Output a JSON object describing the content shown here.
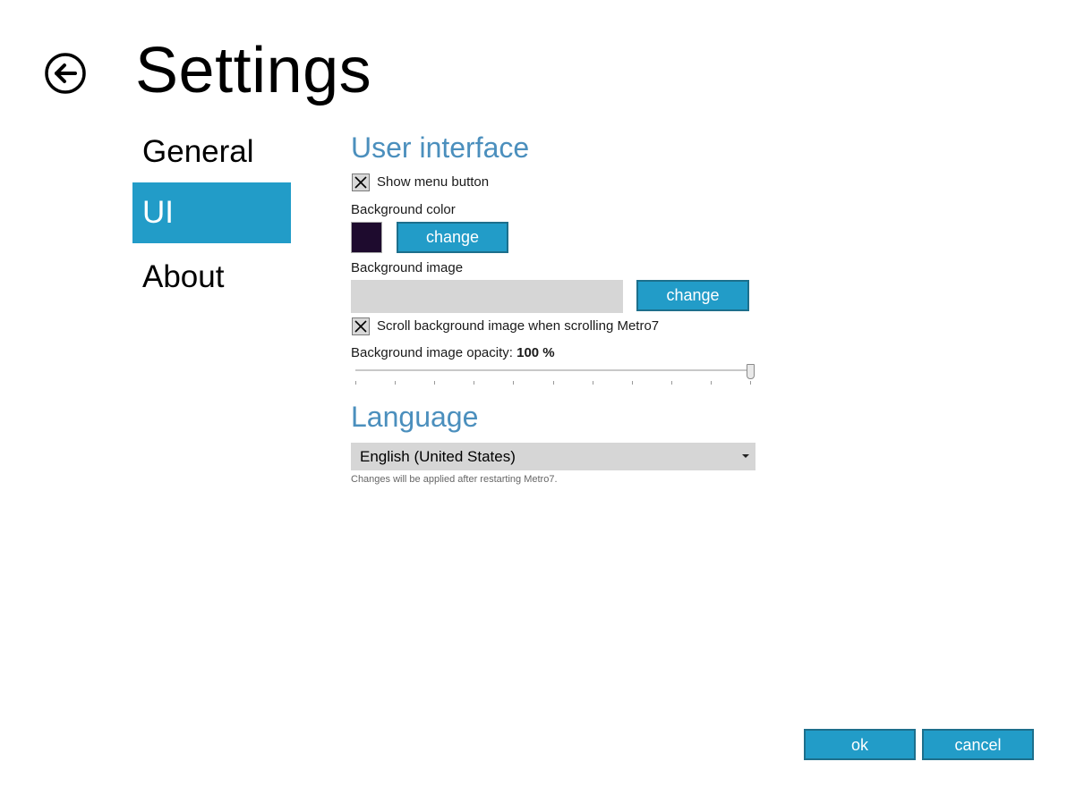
{
  "header": {
    "title": "Settings"
  },
  "nav": {
    "items": [
      {
        "label": "General"
      },
      {
        "label": "UI",
        "selected": true
      },
      {
        "label": "About"
      }
    ]
  },
  "user_interface": {
    "heading": "User interface",
    "show_menu_button": {
      "label": "Show menu button",
      "checked": true
    },
    "background_color": {
      "label": "Background color",
      "value": "#1e0b2e",
      "button_label": "change"
    },
    "background_image": {
      "label": "Background image",
      "value": "",
      "button_label": "change"
    },
    "scroll_background": {
      "label": "Scroll background image when scrolling Metro7",
      "checked": true
    },
    "opacity": {
      "label": "Background image opacity:",
      "value_text": "100 %",
      "value": 100
    }
  },
  "language": {
    "heading": "Language",
    "selected": "English (United States)",
    "hint": "Changes will be applied after restarting Metro7."
  },
  "footer": {
    "ok_label": "ok",
    "cancel_label": "cancel"
  },
  "colors": {
    "accent": "#229cc8",
    "heading": "#4b8fbd"
  }
}
